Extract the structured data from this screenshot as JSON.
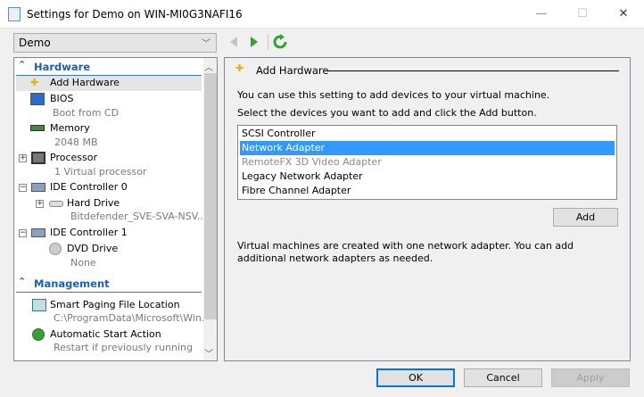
{
  "window": {
    "title": "Settings for Demo on WIN-MI0G3NAFI16",
    "minimize": "—",
    "maximize": "☐",
    "close": "✕"
  },
  "vm_selector": {
    "value": "Demo"
  },
  "nav": {
    "back_icon": "arrow-left-icon",
    "forward_icon": "arrow-right-icon",
    "refresh_icon": "refresh-icon",
    "forward_color": "#2fa52f"
  },
  "tree": {
    "hardware_header": "Hardware",
    "management_header": "Management",
    "items": [
      {
        "label": "Add Hardware"
      },
      {
        "label": "BIOS",
        "sub": "Boot from CD"
      },
      {
        "label": "Memory",
        "sub": "2048 MB"
      },
      {
        "label": "Processor",
        "sub": "1 Virtual processor"
      },
      {
        "label": "IDE Controller 0"
      },
      {
        "label": "Hard Drive",
        "sub": "Bitdefender_SVE-SVA-NSV..."
      },
      {
        "label": "IDE Controller 1"
      },
      {
        "label": "DVD Drive",
        "sub": "None"
      }
    ],
    "management_items": [
      {
        "label": "Smart Paging File Location",
        "sub": "C:\\ProgramData\\Microsoft\\Win..."
      },
      {
        "label": "Automatic Start Action",
        "sub": "Restart if previously running"
      }
    ]
  },
  "main": {
    "title": "Add Hardware",
    "intro": "You can use this setting to add devices to your virtual machine.",
    "instruction": "Select the devices you want to add and click the Add button.",
    "devices": [
      {
        "label": "SCSI Controller"
      },
      {
        "label": "Network Adapter",
        "selected": true
      },
      {
        "label": "RemoteFX 3D Video Adapter",
        "disabled": true
      },
      {
        "label": "Legacy Network Adapter"
      },
      {
        "label": "Fibre Channel Adapter"
      }
    ],
    "add_label": "Add",
    "note": "Virtual machines are created with one network adapter. You can add additional network adapters as needed."
  },
  "footer": {
    "ok": "OK",
    "cancel": "Cancel",
    "apply": "Apply"
  },
  "colors": {
    "selection": "#3399ff",
    "header": "#1c5fb9",
    "ok_border": "#0078d7"
  }
}
